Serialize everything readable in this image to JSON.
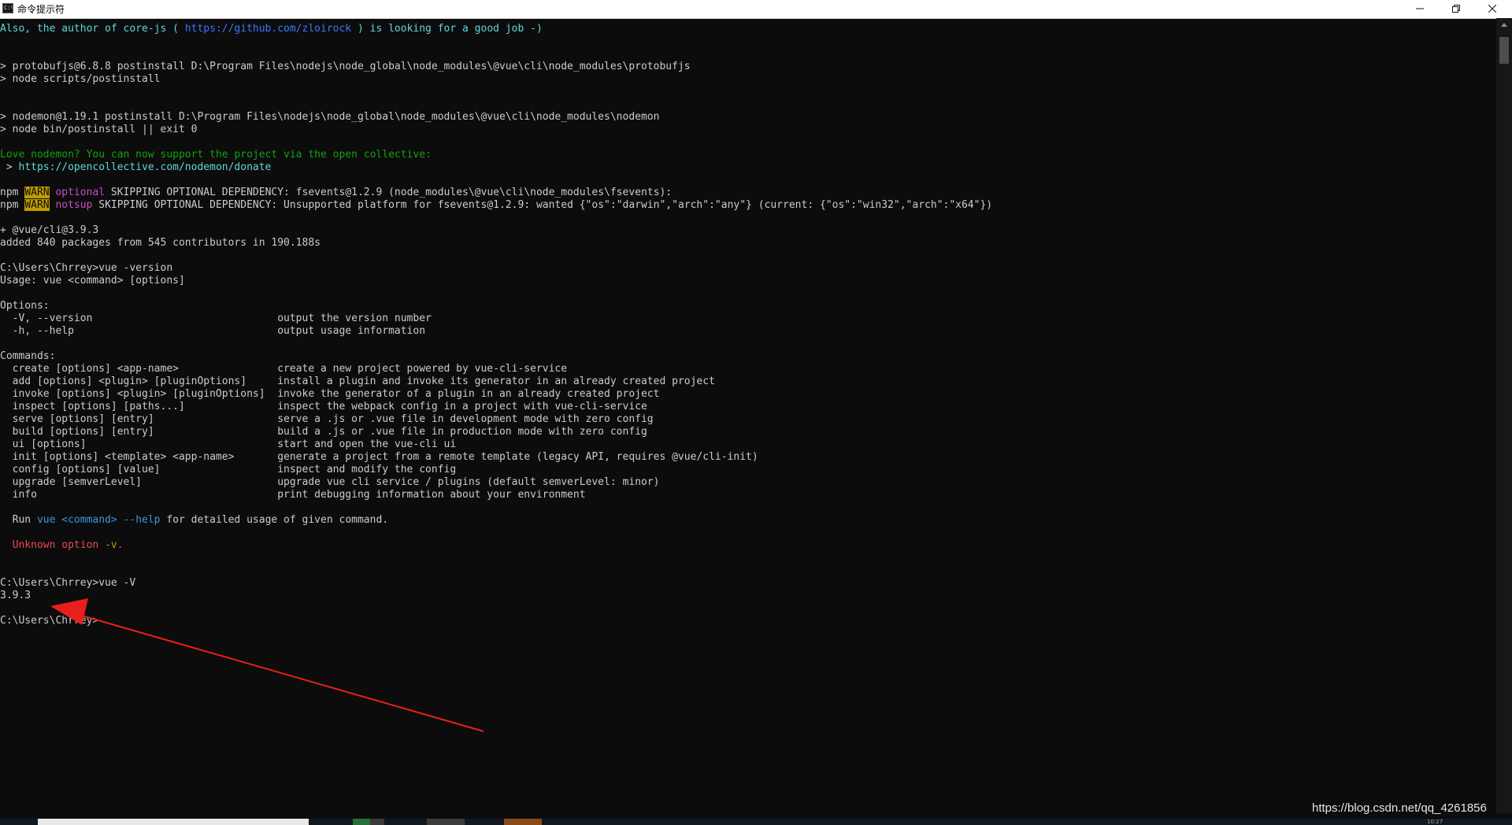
{
  "window": {
    "title": "命令提示符",
    "icon_label": "C:\\"
  },
  "console_lines": [
    {
      "row": 1,
      "segs": [
        {
          "t": "Also, the author of core-js ( ",
          "c": "c-cyan2"
        },
        {
          "t": "https://github.com/zloirock",
          "c": "c-blue"
        },
        {
          "t": " ) is looking for a good job -)",
          "c": "c-cyan2"
        }
      ]
    },
    {
      "row": 4,
      "segs": [
        {
          "t": "> protobufjs@6.8.8 postinstall D:\\Program Files\\nodejs\\node_global\\node_modules\\@vue\\cli\\node_modules\\protobufjs",
          "c": ""
        }
      ]
    },
    {
      "row": 5,
      "segs": [
        {
          "t": "> node scripts/postinstall",
          "c": ""
        }
      ]
    },
    {
      "row": 8,
      "segs": [
        {
          "t": "> nodemon@1.19.1 postinstall D:\\Program Files\\nodejs\\node_global\\node_modules\\@vue\\cli\\node_modules\\nodemon",
          "c": ""
        }
      ]
    },
    {
      "row": 9,
      "segs": [
        {
          "t": "> node bin/postinstall || exit 0",
          "c": ""
        }
      ]
    },
    {
      "row": 11,
      "segs": [
        {
          "t": "Love nodemon? You can now support the project via the open collective:",
          "c": "c-green"
        }
      ]
    },
    {
      "row": 12,
      "segs": [
        {
          "t": " > ",
          "c": ""
        },
        {
          "t": "https://opencollective.com/nodemon/donate",
          "c": "c-cyan2"
        }
      ]
    },
    {
      "row": 14,
      "segs": [
        {
          "t": "npm ",
          "c": ""
        },
        {
          "t": "WARN",
          "c": "warn-badge"
        },
        {
          "t": " ",
          "c": ""
        },
        {
          "t": "optional",
          "c": "c-magenta"
        },
        {
          "t": " SKIPPING OPTIONAL DEPENDENCY: fsevents@1.2.9 (node_modules\\@vue\\cli\\node_modules\\fsevents):",
          "c": ""
        }
      ]
    },
    {
      "row": 15,
      "segs": [
        {
          "t": "npm ",
          "c": ""
        },
        {
          "t": "WARN",
          "c": "warn-badge"
        },
        {
          "t": " ",
          "c": ""
        },
        {
          "t": "notsup",
          "c": "c-magenta"
        },
        {
          "t": " SKIPPING OPTIONAL DEPENDENCY: Unsupported platform for fsevents@1.2.9: wanted {\"os\":\"darwin\",\"arch\":\"any\"} (current: {\"os\":\"win32\",\"arch\":\"x64\"})",
          "c": ""
        }
      ]
    },
    {
      "row": 17,
      "segs": [
        {
          "t": "+ @vue/cli@3.9.3",
          "c": ""
        }
      ]
    },
    {
      "row": 18,
      "segs": [
        {
          "t": "added 840 packages from 545 contributors in 190.188s",
          "c": ""
        }
      ]
    },
    {
      "row": 20,
      "segs": [
        {
          "t": "C:\\Users\\Chrrey>vue -version",
          "c": ""
        }
      ]
    },
    {
      "row": 21,
      "segs": [
        {
          "t": "Usage: vue <command> [options]",
          "c": ""
        }
      ]
    },
    {
      "row": 23,
      "segs": [
        {
          "t": "Options:",
          "c": ""
        }
      ]
    },
    {
      "row": 24,
      "segs": [
        {
          "t": "  -V, --version                              output the version number",
          "c": ""
        }
      ]
    },
    {
      "row": 25,
      "segs": [
        {
          "t": "  -h, --help                                 output usage information",
          "c": ""
        }
      ]
    },
    {
      "row": 27,
      "segs": [
        {
          "t": "Commands:",
          "c": ""
        }
      ]
    },
    {
      "row": 28,
      "segs": [
        {
          "t": "  create [options] <app-name>                create a new project powered by vue-cli-service",
          "c": ""
        }
      ]
    },
    {
      "row": 29,
      "segs": [
        {
          "t": "  add [options] <plugin> [pluginOptions]     install a plugin and invoke its generator in an already created project",
          "c": ""
        }
      ]
    },
    {
      "row": 30,
      "segs": [
        {
          "t": "  invoke [options] <plugin> [pluginOptions]  invoke the generator of a plugin in an already created project",
          "c": ""
        }
      ]
    },
    {
      "row": 31,
      "segs": [
        {
          "t": "  inspect [options] [paths...]               inspect the webpack config in a project with vue-cli-service",
          "c": ""
        }
      ]
    },
    {
      "row": 32,
      "segs": [
        {
          "t": "  serve [options] [entry]                    serve a .js or .vue file in development mode with zero config",
          "c": ""
        }
      ]
    },
    {
      "row": 33,
      "segs": [
        {
          "t": "  build [options] [entry]                    build a .js or .vue file in production mode with zero config",
          "c": ""
        }
      ]
    },
    {
      "row": 34,
      "segs": [
        {
          "t": "  ui [options]                               start and open the vue-cli ui",
          "c": ""
        }
      ]
    },
    {
      "row": 35,
      "segs": [
        {
          "t": "  init [options] <template> <app-name>       generate a project from a remote template (legacy API, requires @vue/cli-init)",
          "c": ""
        }
      ]
    },
    {
      "row": 36,
      "segs": [
        {
          "t": "  config [options] [value]                   inspect and modify the config",
          "c": ""
        }
      ]
    },
    {
      "row": 37,
      "segs": [
        {
          "t": "  upgrade [semverLevel]                      upgrade vue cli service / plugins (default semverLevel: minor)",
          "c": ""
        }
      ]
    },
    {
      "row": 38,
      "segs": [
        {
          "t": "  info                                       print debugging information about your environment",
          "c": ""
        }
      ]
    },
    {
      "row": 40,
      "segs": [
        {
          "t": "  Run ",
          "c": ""
        },
        {
          "t": "vue <command> --help",
          "c": "c-cyan"
        },
        {
          "t": " for detailed usage of given command.",
          "c": ""
        }
      ]
    },
    {
      "row": 42,
      "segs": [
        {
          "t": "  Unknown option ",
          "c": "c-red"
        },
        {
          "t": "-v",
          "c": "c-yellow"
        },
        {
          "t": ".",
          "c": "c-red"
        }
      ]
    },
    {
      "row": 45,
      "segs": [
        {
          "t": "C:\\Users\\Chrrey>vue -V",
          "c": ""
        }
      ]
    },
    {
      "row": 46,
      "segs": [
        {
          "t": "3.9.3",
          "c": ""
        }
      ]
    },
    {
      "row": 48,
      "segs": [
        {
          "t": "C:\\Users\\Chrrey>",
          "c": ""
        }
      ]
    }
  ],
  "watermark": "https://blog.csdn.net/qq_4261856",
  "taskbar": {
    "clock": "10:27"
  },
  "colors": {
    "background": "#0c0c0c",
    "text": "#cccccc",
    "arrow": "#e8201c",
    "warn": "#c19c00"
  }
}
